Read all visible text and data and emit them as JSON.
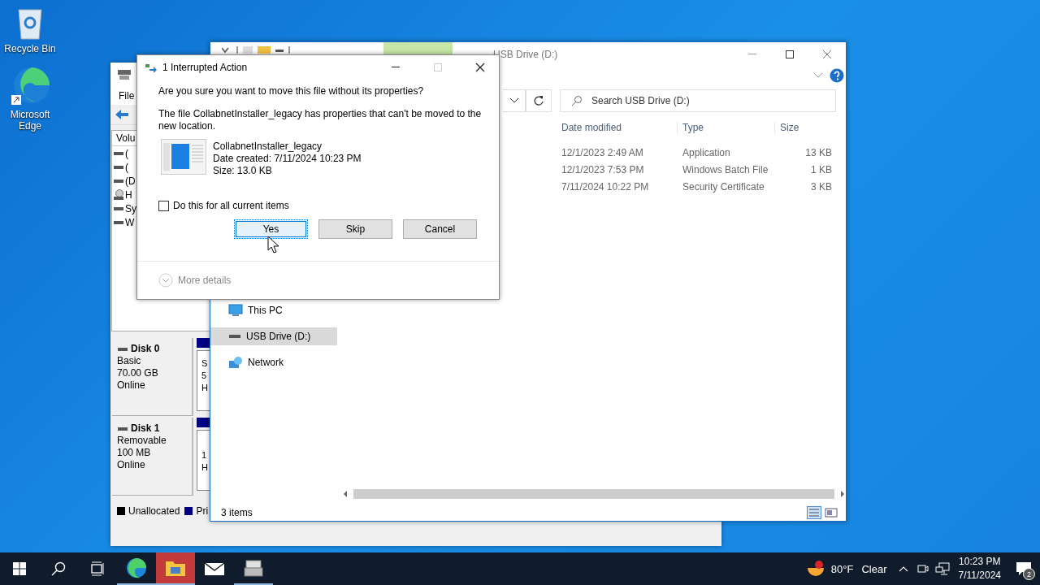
{
  "desktop_icons": [
    {
      "kind": "recycle",
      "label": "Recycle Bin"
    },
    {
      "kind": "edge",
      "label": "Microsoft Edge"
    }
  ],
  "disk_management": {
    "menu": [
      "File"
    ],
    "volume_header": "Volu",
    "volumes": [
      {
        "kind": "drive",
        "text": "("
      },
      {
        "kind": "drive",
        "text": "("
      },
      {
        "kind": "drive",
        "text": "(D"
      },
      {
        "kind": "cd",
        "text": "H"
      },
      {
        "kind": "drive",
        "text": "Sy"
      },
      {
        "kind": "drive",
        "text": "W"
      }
    ],
    "disks": [
      {
        "name": "Disk 0",
        "type": "Basic",
        "size": "70.00 GB",
        "status": "Online",
        "partition_lines": [
          "S",
          "5",
          "H"
        ]
      },
      {
        "name": "Disk 1",
        "type": "Removable",
        "size": "100 MB",
        "status": "Online",
        "partition_lines": [
          "1",
          "H"
        ]
      }
    ],
    "legend": [
      {
        "label": "Unallocated",
        "color": "#000000"
      },
      {
        "label": "Pri",
        "color": "#000080"
      }
    ]
  },
  "explorer": {
    "title": "USB Drive (D:)",
    "search": {
      "placeholder": "Search USB Drive (D:)"
    },
    "columns": [
      "Date modified",
      "Type",
      "Size"
    ],
    "rows": [
      {
        "date": "12/1/2023 2:49 AM",
        "type": "Application",
        "size": "13 KB"
      },
      {
        "date": "12/1/2023 7:53 PM",
        "type": "Windows Batch File",
        "size": "1 KB"
      },
      {
        "date": "7/11/2024 10:22 PM",
        "type": "Security Certificate",
        "size": "3 KB"
      }
    ],
    "nav": [
      {
        "kind": "pc",
        "label": "This PC",
        "selected": false
      },
      {
        "kind": "usb",
        "label": "USB Drive (D:)",
        "selected": true
      },
      {
        "kind": "network",
        "label": "Network",
        "selected": false
      }
    ],
    "status": "3 items"
  },
  "dialog": {
    "title": "1 Interrupted Action",
    "question": "Are you sure you want to move this file without its properties?",
    "message": "The file CollabnetInstaller_legacy has properties that can't be moved to the new location.",
    "file": {
      "name": "CollabnetInstaller_legacy",
      "created": "Date created: 7/11/2024 10:23 PM",
      "size": "Size: 13.0 KB"
    },
    "apply_all": {
      "label": "Do this for all current items",
      "checked": false
    },
    "buttons": [
      {
        "label": "Yes",
        "focused": true
      },
      {
        "label": "Skip",
        "focused": false
      },
      {
        "label": "Cancel",
        "focused": false
      }
    ],
    "more_details": "More details"
  },
  "taskbar": {
    "apps": [
      {
        "kind": "edge",
        "running": true,
        "active": false
      },
      {
        "kind": "explorer",
        "running": true,
        "active": true
      },
      {
        "kind": "mail",
        "running": false,
        "active": false
      },
      {
        "kind": "app",
        "running": true,
        "active": false
      }
    ],
    "weather": {
      "temperature": "80°F",
      "condition": "Clear"
    },
    "time": "10:23 PM",
    "date": "7/11/2024",
    "notification_count": "2"
  }
}
